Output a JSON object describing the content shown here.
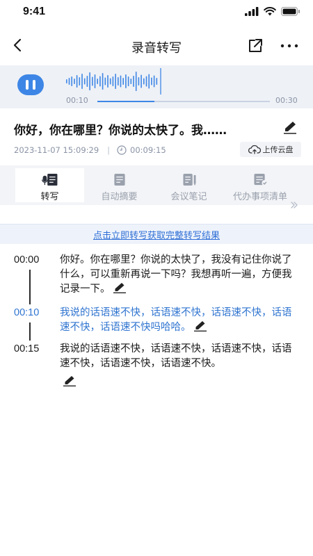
{
  "status_bar": {
    "time": "9:41"
  },
  "nav": {
    "title": "录音转写"
  },
  "player": {
    "current_time": "00:10",
    "total_time": "00:30",
    "progress": 0.33,
    "colors": {
      "accent": "#3d86e6",
      "track": "#c8d2e2",
      "bg": "#eef1f6"
    }
  },
  "recording": {
    "title": "你好，你在哪里？你说的太快了。我……",
    "date": "2023-11-07 15:09:29",
    "duration": "00:09:15",
    "cloud_label": "上传云盘"
  },
  "tabs": [
    {
      "label": "转写",
      "icon": "transcribe-icon",
      "active": true
    },
    {
      "label": "自动摘要",
      "icon": "summary-icon",
      "active": false
    },
    {
      "label": "会议笔记",
      "icon": "notes-icon",
      "active": false
    },
    {
      "label": "代办事项清单",
      "icon": "todo-list-icon",
      "active": false
    }
  ],
  "banner": {
    "text": "点击立即转写获取完整转写结果"
  },
  "transcript": [
    {
      "time": "00:00",
      "text": "你好。你在哪里？你说的太快了，我没有记住你说了什么，可以重新再说一下吗？我想再听一遍，方便我记录一下。",
      "active": false
    },
    {
      "time": "00:10",
      "text": "我说的话语速不快，话语速不快，话语速不快，话语速不快，话语速不快吗哈哈。",
      "active": true
    },
    {
      "time": "00:15",
      "text": "我说的话语速不快，话语速不快，话语速不快，话语速不快，话语速不快，话语速不快。",
      "active": false
    }
  ],
  "colors": {
    "active_text": "#2f74d0",
    "link": "#2f6fd6",
    "muted": "#8a93a5"
  }
}
